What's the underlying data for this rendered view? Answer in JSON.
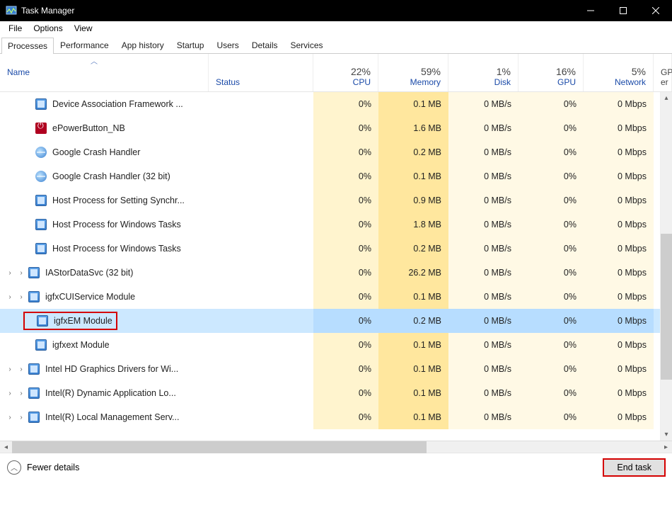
{
  "window": {
    "title": "Task Manager"
  },
  "menu": [
    "File",
    "Options",
    "View"
  ],
  "tabs": [
    "Processes",
    "Performance",
    "App history",
    "Startup",
    "Users",
    "Details",
    "Services"
  ],
  "activeTab": 0,
  "columns": {
    "name": "Name",
    "status": "Status",
    "cpu": {
      "pct": "22%",
      "label": "CPU"
    },
    "memory": {
      "pct": "59%",
      "label": "Memory"
    },
    "disk": {
      "pct": "1%",
      "label": "Disk"
    },
    "gpu": {
      "pct": "16%",
      "label": "GPU"
    },
    "network": {
      "pct": "5%",
      "label": "Network"
    },
    "extra": "GPU er"
  },
  "rows": [
    {
      "icon": "generic",
      "name": "Device Association Framework ...",
      "cpu": "0%",
      "mem": "0.1 MB",
      "disk": "0 MB/s",
      "gpu": "0%",
      "net": "0 Mbps",
      "expandable": false
    },
    {
      "icon": "red",
      "name": "ePowerButton_NB",
      "cpu": "0%",
      "mem": "1.6 MB",
      "disk": "0 MB/s",
      "gpu": "0%",
      "net": "0 Mbps",
      "expandable": false
    },
    {
      "icon": "globe",
      "name": "Google Crash Handler",
      "cpu": "0%",
      "mem": "0.2 MB",
      "disk": "0 MB/s",
      "gpu": "0%",
      "net": "0 Mbps",
      "expandable": false
    },
    {
      "icon": "globe",
      "name": "Google Crash Handler (32 bit)",
      "cpu": "0%",
      "mem": "0.1 MB",
      "disk": "0 MB/s",
      "gpu": "0%",
      "net": "0 Mbps",
      "expandable": false
    },
    {
      "icon": "generic",
      "name": "Host Process for Setting Synchr...",
      "cpu": "0%",
      "mem": "0.9 MB",
      "disk": "0 MB/s",
      "gpu": "0%",
      "net": "0 Mbps",
      "expandable": false
    },
    {
      "icon": "generic",
      "name": "Host Process for Windows Tasks",
      "cpu": "0%",
      "mem": "1.8 MB",
      "disk": "0 MB/s",
      "gpu": "0%",
      "net": "0 Mbps",
      "expandable": false
    },
    {
      "icon": "generic",
      "name": "Host Process for Windows Tasks",
      "cpu": "0%",
      "mem": "0.2 MB",
      "disk": "0 MB/s",
      "gpu": "0%",
      "net": "0 Mbps",
      "expandable": false
    },
    {
      "icon": "generic",
      "name": "IAStorDataSvc (32 bit)",
      "cpu": "0%",
      "mem": "26.2 MB",
      "disk": "0 MB/s",
      "gpu": "0%",
      "net": "0 Mbps",
      "expandable": true
    },
    {
      "icon": "generic",
      "name": "igfxCUIService Module",
      "cpu": "0%",
      "mem": "0.1 MB",
      "disk": "0 MB/s",
      "gpu": "0%",
      "net": "0 Mbps",
      "expandable": true
    },
    {
      "icon": "generic",
      "name": "igfxEM Module",
      "cpu": "0%",
      "mem": "0.2 MB",
      "disk": "0 MB/s",
      "gpu": "0%",
      "net": "0 Mbps",
      "expandable": false,
      "selected": true,
      "highlightName": true
    },
    {
      "icon": "generic",
      "name": "igfxext Module",
      "cpu": "0%",
      "mem": "0.1 MB",
      "disk": "0 MB/s",
      "gpu": "0%",
      "net": "0 Mbps",
      "expandable": false
    },
    {
      "icon": "generic",
      "name": "Intel HD Graphics Drivers for Wi...",
      "cpu": "0%",
      "mem": "0.1 MB",
      "disk": "0 MB/s",
      "gpu": "0%",
      "net": "0 Mbps",
      "expandable": true
    },
    {
      "icon": "generic",
      "name": "Intel(R) Dynamic Application Lo...",
      "cpu": "0%",
      "mem": "0.1 MB",
      "disk": "0 MB/s",
      "gpu": "0%",
      "net": "0 Mbps",
      "expandable": true
    },
    {
      "icon": "generic",
      "name": "Intel(R) Local Management Serv...",
      "cpu": "0%",
      "mem": "0.1 MB",
      "disk": "0 MB/s",
      "gpu": "0%",
      "net": "0 Mbps",
      "expandable": true
    }
  ],
  "footer": {
    "fewer": "Fewer details",
    "endTask": "End task"
  }
}
